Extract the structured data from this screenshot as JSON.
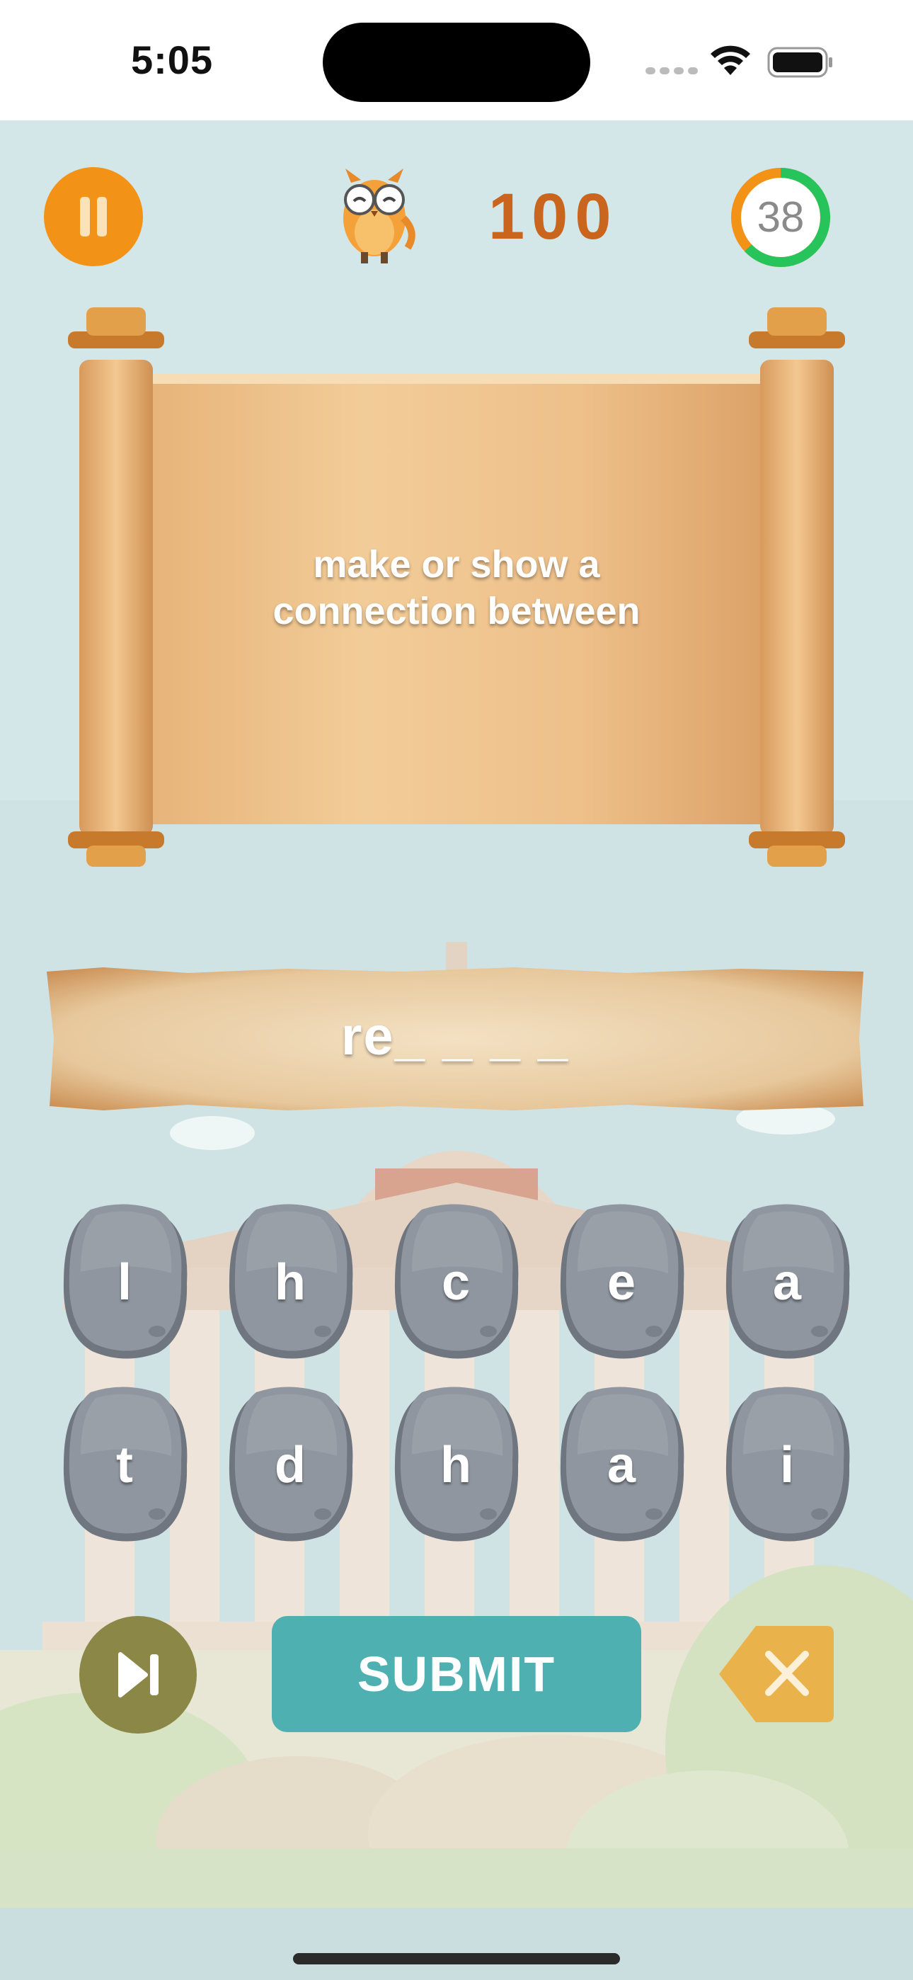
{
  "status_bar": {
    "time": "5:05"
  },
  "hud": {
    "score": "100",
    "timer_value": "38",
    "timer_progress": 0.63
  },
  "clue": {
    "line1": "make or show a",
    "line2": "connection between"
  },
  "answer": {
    "display": "re_ _ _ _"
  },
  "letter_tiles": [
    "l",
    "h",
    "c",
    "e",
    "a",
    "t",
    "d",
    "h",
    "a",
    "i"
  ],
  "actions": {
    "submit_label": "SUBMIT"
  },
  "icons": {
    "pause": "pause-icon",
    "mascot": "owl-mascot-icon",
    "skip": "skip-next-icon",
    "delete": "backspace-icon",
    "wifi": "wifi-icon",
    "battery": "battery-icon"
  },
  "colors": {
    "accent_orange": "#f29318",
    "score_color": "#c9651d",
    "timer_green": "#27c45b",
    "submit_teal": "#4fb0b1",
    "skip_olive": "#8a8747",
    "delete_amber": "#eab24a"
  }
}
